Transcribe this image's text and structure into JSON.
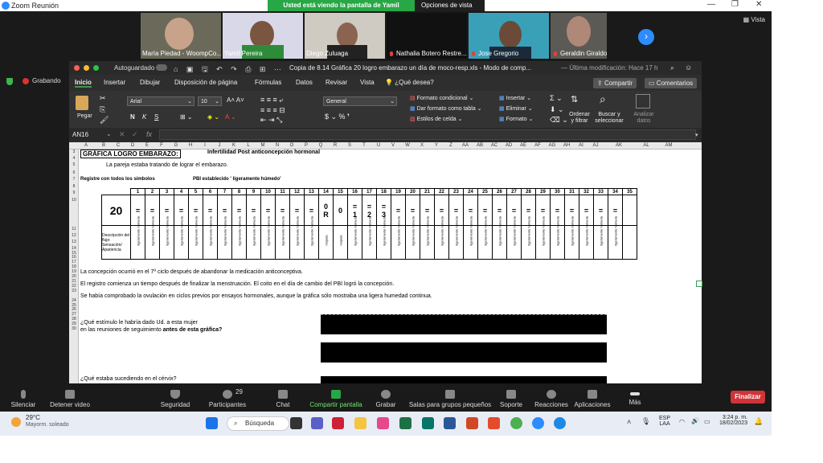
{
  "zoom": {
    "app_title": "Zoom Reunión",
    "share_banner": "Usted está viendo la pantalla de Yamil Pereira",
    "view_options": "Opciones de vista",
    "view_label": "Vista",
    "recording": "Grabando",
    "participants": [
      {
        "name": "María Piedad - WoompCo..."
      },
      {
        "name": "Yamil Pereira"
      },
      {
        "name": "Diego Zuluaga"
      },
      {
        "name": "Nathalia Botero Restre..."
      },
      {
        "name": "Jose Gregorio"
      },
      {
        "name": "Geraldin Giraldo"
      }
    ],
    "toolbar": {
      "mute": "Silenciar",
      "stop_video": "Detener video",
      "security": "Seguridad",
      "participants": "Participantes",
      "participants_count": "29",
      "chat": "Chat",
      "share": "Compartir pantalla",
      "record": "Grabar",
      "breakout": "Salas para grupos pequeños",
      "support": "Soporte",
      "reactions": "Reacciones",
      "apps": "Aplicaciones",
      "more": "Más",
      "end": "Finalizar"
    }
  },
  "excel": {
    "autosave": "Autoguardado",
    "doc_title": "Copia de 8.14 Gráfica 20 logro embarazo un día de moco-resp.xls  -  Modo de comp...",
    "last_modified": "— Última modificación: Hace 17 h",
    "tabs": [
      "Inicio",
      "Insertar",
      "Dibujar",
      "Disposición de página",
      "Fórmulas",
      "Datos",
      "Revisar",
      "Vista"
    ],
    "tell_me": "¿Qué desea?",
    "share_btn": "Compartir",
    "comments_btn": "Comentarios",
    "ribbon": {
      "paste": "Pegar",
      "font": "Arial",
      "font_size": "10",
      "number_format": "General",
      "cond_format": "Formato condicional",
      "format_table": "Dar formato como tabla",
      "cell_styles": "Estilos de celda",
      "insert": "Insertar",
      "delete": "Eliminar",
      "format": "Formato",
      "sort": "Ordenar y filtrar",
      "find": "Buscar y seleccionar",
      "analyze": "Analizar datos"
    },
    "namebox": "AN16",
    "fx": "fx",
    "columns": [
      "A",
      "B",
      "C",
      "D",
      "E",
      "F",
      "G",
      "H",
      "I",
      "J",
      "K",
      "L",
      "M",
      "N",
      "O",
      "P",
      "Q",
      "R",
      "S",
      "T",
      "U",
      "V",
      "W",
      "X",
      "Y",
      "Z",
      "AA",
      "AB",
      "AC",
      "AD",
      "AE",
      "AF",
      "AG",
      "AH",
      "AI",
      "AJ",
      "AK",
      "AL",
      "AM"
    ],
    "rows": [
      "3",
      "4",
      "5",
      "6",
      "7",
      "8",
      "9",
      "10",
      "11",
      "12",
      "13",
      "14",
      "15",
      "16",
      "17",
      "18",
      "19",
      "20",
      "21",
      "22",
      "23",
      "24",
      "25",
      "26",
      "27",
      "28",
      "29",
      "30"
    ],
    "cells": {
      "title": "GRÁFICA LOGRO EMBARAZO:",
      "subtitle": "Infertilidad Post anticoncepción hormonal",
      "line5": "La pareja estaba tratando de lograr el embarazo.",
      "line7a": "Registre con todos los símbolos",
      "line7b": "PBI establecido ' ligeramente húmedo'",
      "cycle_number": "20",
      "desc_label": "Descripción del flujo: Sensación/ Apariencia",
      "line14": "La concepción ocurrió en el 7º ciclo después de abandonar la medicación anticonceptiva.",
      "line16": "El registro comienza un tiempo después de finalizar la menstruación. El coito en el día de cambio del PBI logró la concepción.",
      "line18": "Se había comprobado la ovulación en ciclos previos por ensayos hormonales, aunque la gráfica sólo mostraba una ligera humedad continua.",
      "q1a": "¿Qué estímulo le habría dado Ud. a esta mujer",
      "q1b": "en las reuniones de seguimiento",
      "q1c": "antes de esta gráfica?",
      "q2": "¿Qué estaba sucediendo en el cérvix?"
    },
    "day_numbers": [
      "1",
      "2",
      "3",
      "4",
      "5",
      "6",
      "7",
      "8",
      "9",
      "10",
      "11",
      "12",
      "13",
      "14",
      "15",
      "16",
      "17",
      "18",
      "19",
      "20",
      "21",
      "22",
      "23",
      "24",
      "25",
      "26",
      "27",
      "28",
      "29",
      "30",
      "31",
      "32",
      "33",
      "34",
      "35"
    ],
    "symbols": [
      "=",
      "=",
      "=",
      "=",
      "=",
      "=",
      "=",
      "=",
      "=",
      "=",
      "=",
      "=",
      "=",
      "0 R",
      "0",
      "= 1",
      "= 2",
      "= 3",
      "=",
      "=",
      "=",
      "=",
      "=",
      "=",
      "=",
      "=",
      "=",
      "=",
      "=",
      "=",
      "=",
      "=",
      "=",
      "=",
      ""
    ],
    "vertical_desc": "ligeramente húmeda",
    "vertical_desc_alt": "mojada"
  },
  "taskbar": {
    "temp": "29°C",
    "weather": "Mayorm. soleado",
    "search": "Búsqueda",
    "lang": "ESP",
    "lang2": "LAA",
    "time": "3:24 p. m.",
    "date": "18/02/2023"
  }
}
